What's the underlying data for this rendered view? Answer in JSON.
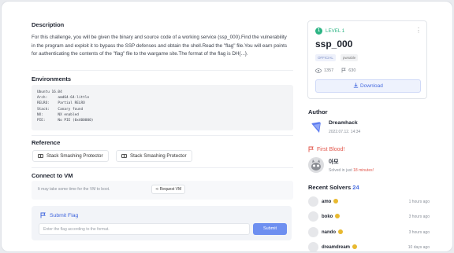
{
  "description": {
    "heading": "Description",
    "text": "For this challenge, you will be given the binary and source code of a working service (ssp_000).Find the vulnerability in the program and exploit it to bypass the SSP defenses and obtain the shell.Read the \"flag\" file.You will earn points for authenticating the contents of the \"flag\" file to the wargame site.The format of the flag is DH{...}."
  },
  "environments": {
    "heading": "Environments",
    "lines": [
      "Ubuntu 16.04",
      "Arch:     amd64-64-little",
      "RELRO:    Partial RELRO",
      "Stack:    Canary found",
      "NX:       NX enabled",
      "PIE:      No PIE (0x400000)"
    ]
  },
  "reference": {
    "heading": "Reference",
    "items": [
      "Stack Smashing Protector",
      "Stack Smashing Protector"
    ]
  },
  "vm": {
    "heading": "Connect to VM",
    "note": "It may take some time for the VM to boot.",
    "request_label": "Request VM"
  },
  "submit": {
    "title": "Submit Flag",
    "placeholder": "Enter the flag according to the format.",
    "button": "Submit"
  },
  "challenge": {
    "level_number": "1",
    "level_label": "LEVEL 1",
    "title": "ssp_000",
    "tags": [
      "OFFICIAL",
      "pwnable"
    ],
    "views": "1357",
    "solves": "630",
    "download": "Download"
  },
  "author": {
    "heading": "Author",
    "name": "Dreamhack",
    "date": "2022.07.12. 14:34"
  },
  "first_blood": {
    "heading": "First Blood!",
    "name": "아모",
    "note_prefix": "Solved in just",
    "note_time": "18 minutes!"
  },
  "recent": {
    "heading": "Recent Solvers",
    "count": "24",
    "solvers": [
      {
        "name": "amo",
        "time": "1 hours ago"
      },
      {
        "name": "boko",
        "time": "3 hours ago"
      },
      {
        "name": "nando",
        "time": "3 hours ago"
      },
      {
        "name": "dreamdream",
        "time": "10 days ago"
      }
    ]
  },
  "colors": {
    "accent": "#4a6ee0",
    "level": "#2cb484",
    "first_blood": "#e2574c",
    "badge": "#e8b930"
  },
  "icons": [
    "book-icon",
    "link-icon",
    "flag-icon",
    "eye-icon",
    "download-icon",
    "kebab-icon"
  ]
}
